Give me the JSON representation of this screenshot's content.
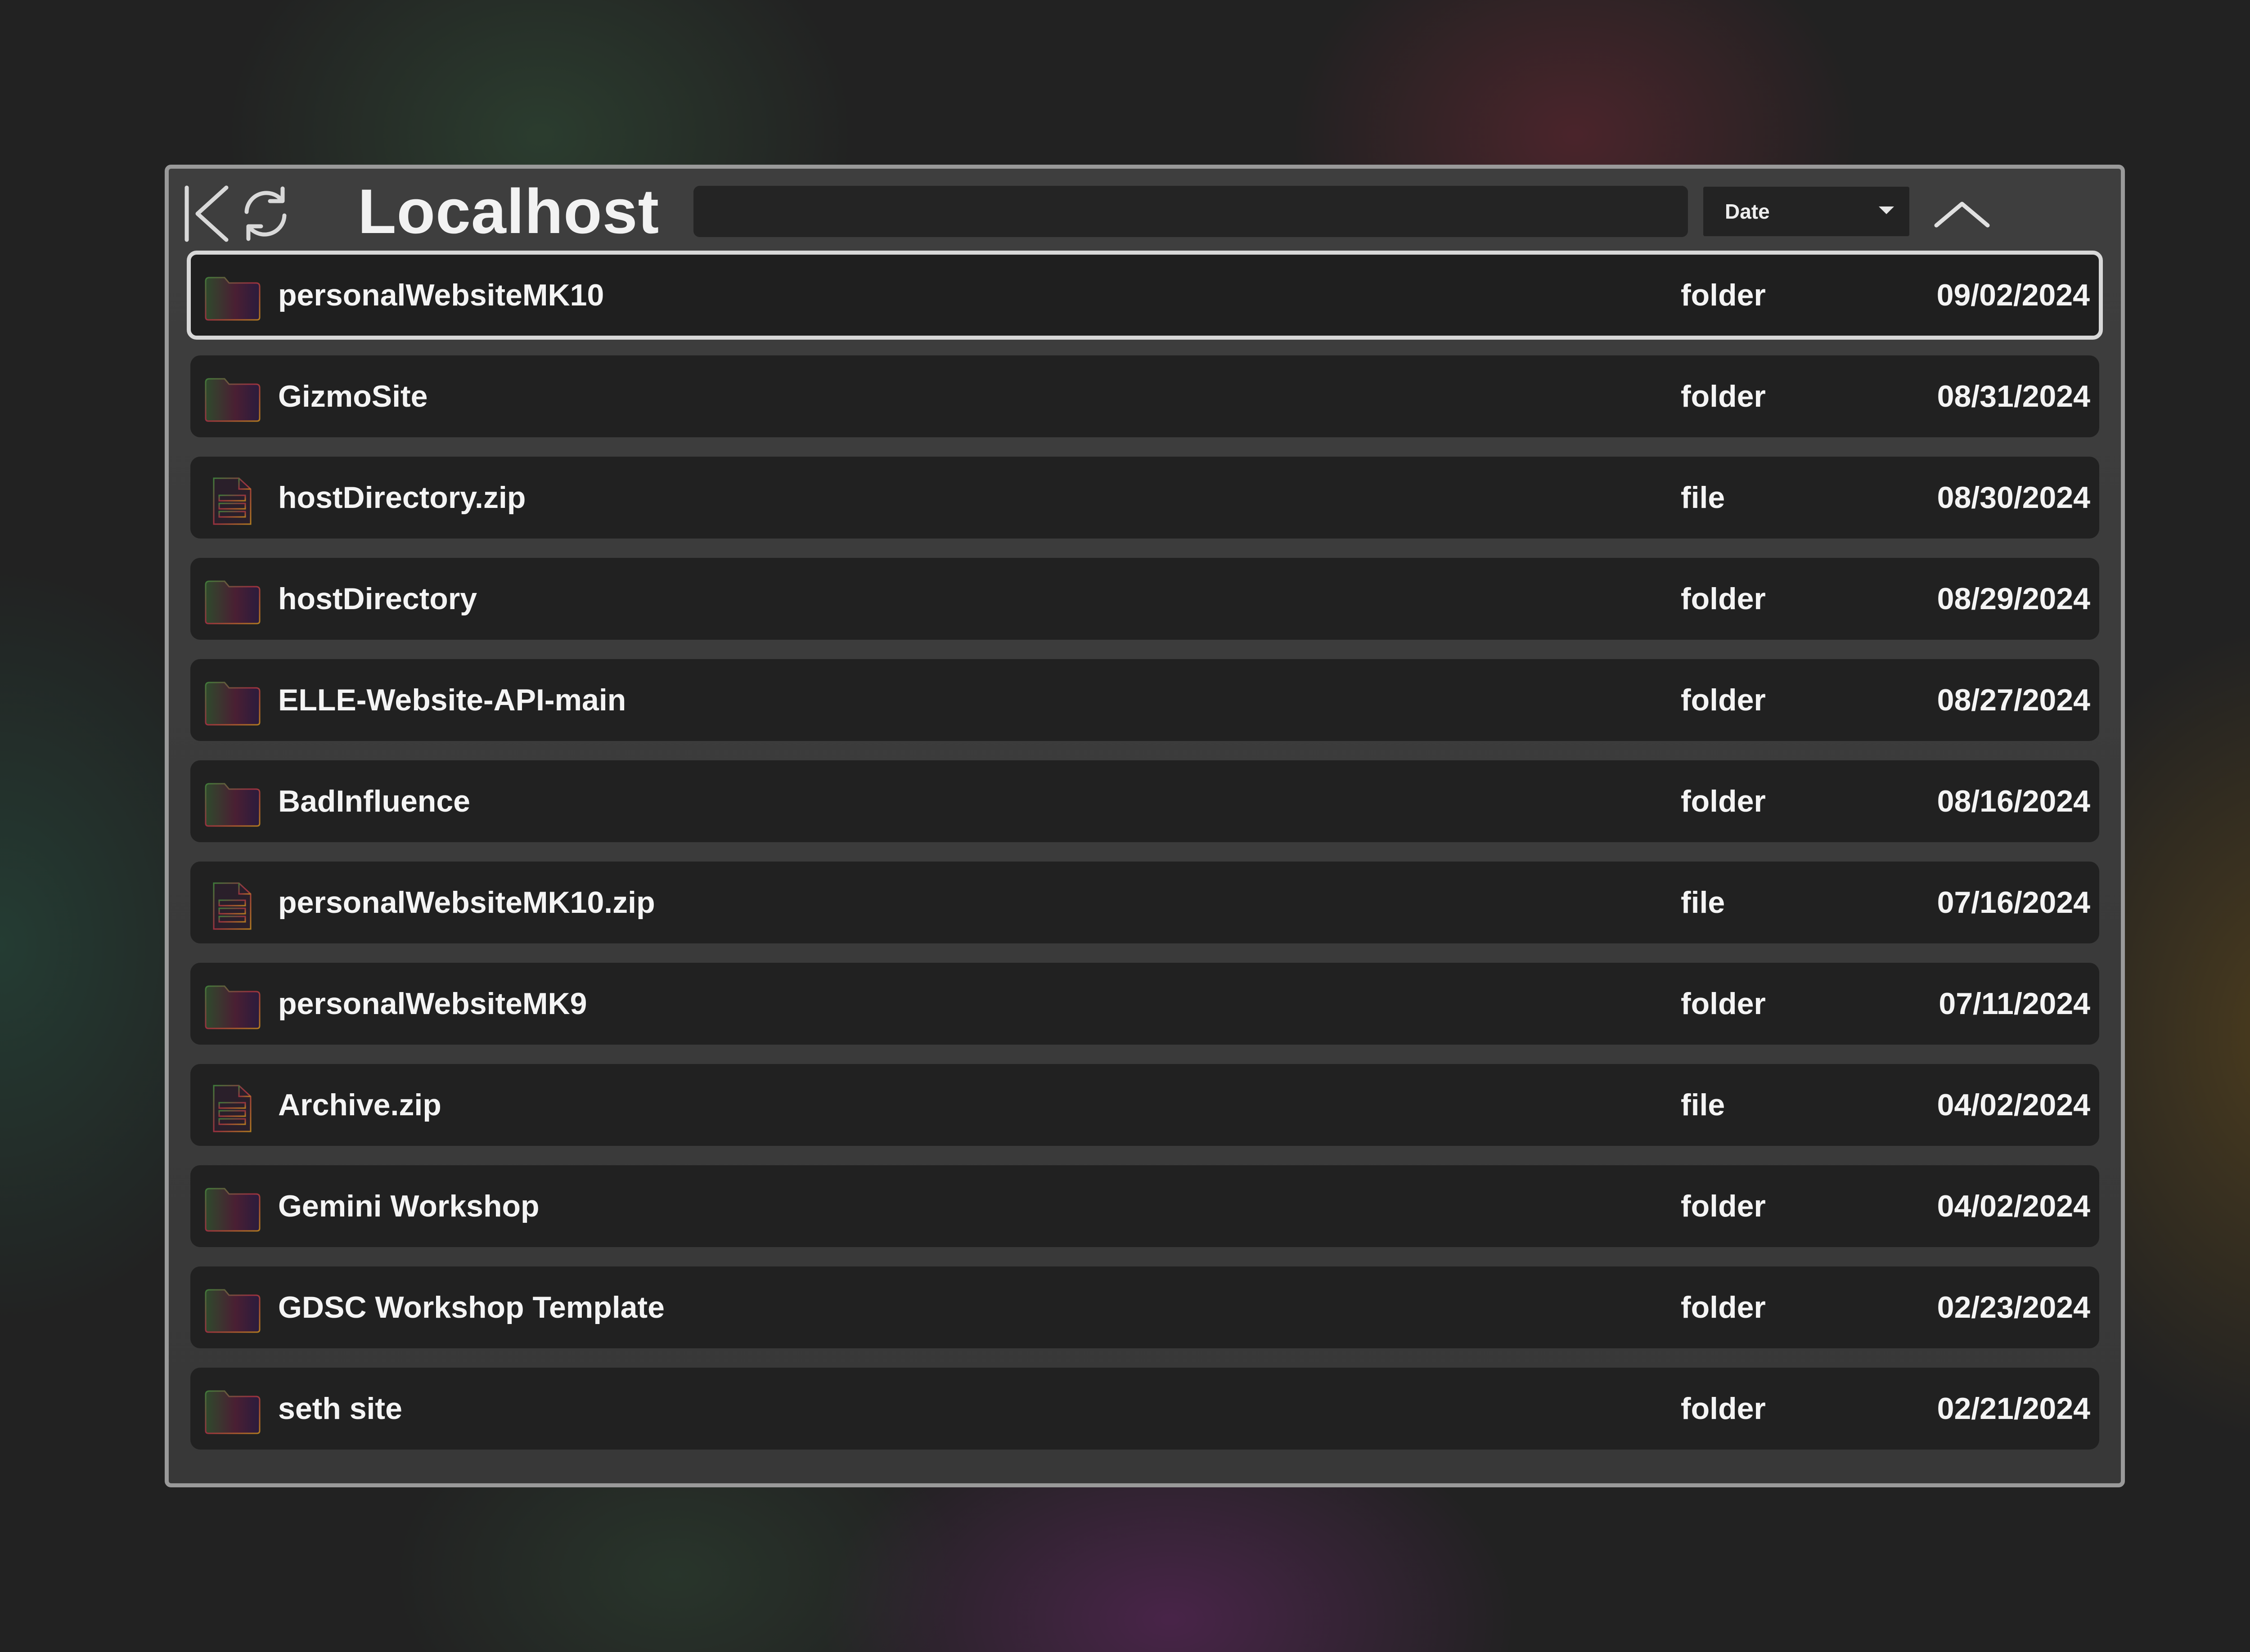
{
  "window": {
    "title": "Localhost"
  },
  "toolbar": {
    "back_icon": "back-to-start-icon",
    "refresh_icon": "refresh-icon",
    "search": {
      "value": "",
      "placeholder": ""
    },
    "sort": {
      "selected": "Date",
      "caret_icon": "caret-down-icon"
    },
    "order_icon": "chevron-up-icon"
  },
  "colors": {
    "row_background": "#212121",
    "window_background": "#3b3b3b",
    "selected_border": "#d8d8d8",
    "text": "#f4f4f4"
  },
  "files": [
    {
      "name": "personalWebsiteMK10",
      "type": "folder",
      "date": "09/02/2024",
      "icon": "folder-icon",
      "selected": true
    },
    {
      "name": "GizmoSite",
      "type": "folder",
      "date": "08/31/2024",
      "icon": "folder-icon"
    },
    {
      "name": "hostDirectory.zip",
      "type": "file",
      "date": "08/30/2024",
      "icon": "file-icon"
    },
    {
      "name": "hostDirectory",
      "type": "folder",
      "date": "08/29/2024",
      "icon": "folder-icon"
    },
    {
      "name": "ELLE-Website-API-main",
      "type": "folder",
      "date": "08/27/2024",
      "icon": "folder-icon"
    },
    {
      "name": "BadInfluence",
      "type": "folder",
      "date": "08/16/2024",
      "icon": "folder-icon"
    },
    {
      "name": "personalWebsiteMK10.zip",
      "type": "file",
      "date": "07/16/2024",
      "icon": "file-icon"
    },
    {
      "name": "personalWebsiteMK9",
      "type": "folder",
      "date": "07/11/2024",
      "icon": "folder-icon"
    },
    {
      "name": "Archive.zip",
      "type": "file",
      "date": "04/02/2024",
      "icon": "file-icon"
    },
    {
      "name": "Gemini Workshop",
      "type": "folder",
      "date": "04/02/2024",
      "icon": "folder-icon"
    },
    {
      "name": "GDSC Workshop Template",
      "type": "folder",
      "date": "02/23/2024",
      "icon": "folder-icon"
    },
    {
      "name": "seth site",
      "type": "folder",
      "date": "02/21/2024",
      "icon": "folder-icon"
    }
  ]
}
